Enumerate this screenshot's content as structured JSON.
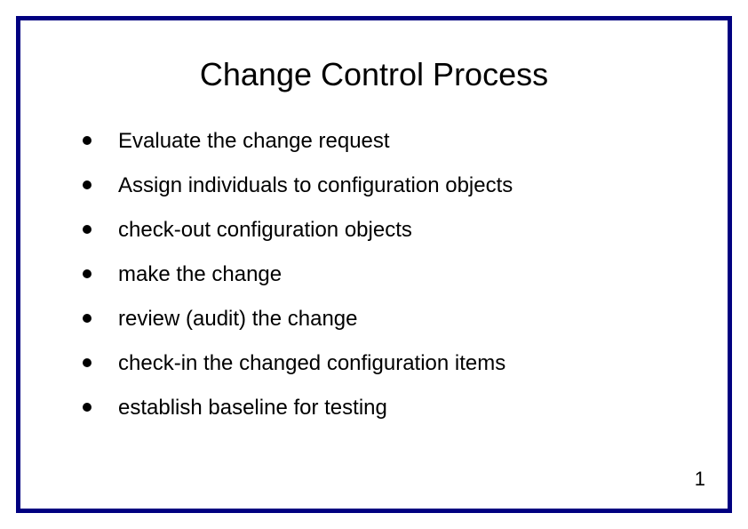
{
  "title": "Change Control Process",
  "bullets": [
    "Evaluate the change request",
    "Assign individuals to configuration objects",
    "check-out configuration objects",
    "make the change",
    "review (audit) the change",
    "check-in the changed configuration items",
    "establish baseline for testing"
  ],
  "page_number": "1"
}
